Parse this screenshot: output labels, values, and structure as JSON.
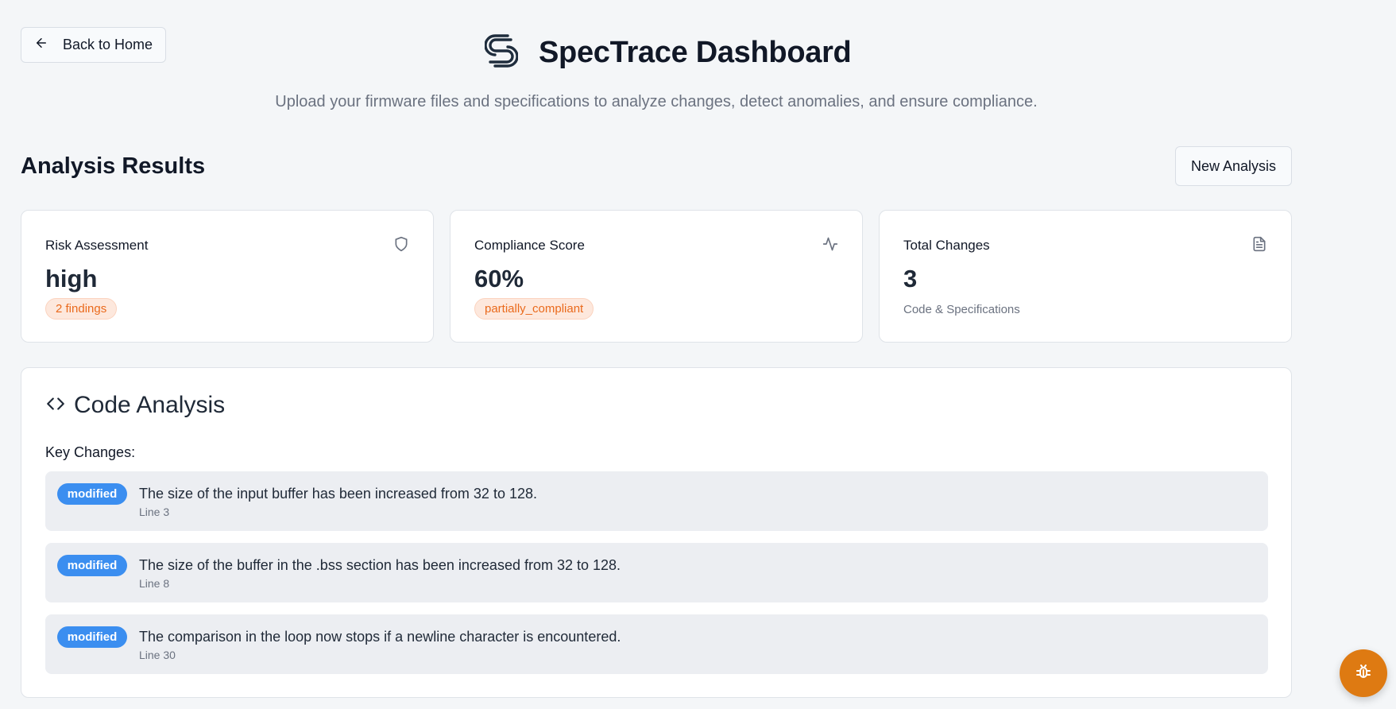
{
  "nav": {
    "back_label": "Back to Home"
  },
  "header": {
    "title": "SpecTrace Dashboard",
    "subtitle": "Upload your firmware files and specifications to analyze changes, detect anomalies, and ensure compliance."
  },
  "results": {
    "title": "Analysis Results",
    "new_analysis_label": "New Analysis"
  },
  "cards": {
    "risk": {
      "label": "Risk Assessment",
      "value": "high",
      "badge": "2 findings",
      "icon": "shield-icon"
    },
    "compliance": {
      "label": "Compliance Score",
      "value": "60%",
      "badge": "partially_compliant",
      "icon": "activity-icon"
    },
    "changes": {
      "label": "Total Changes",
      "value": "3",
      "note": "Code & Specifications",
      "icon": "document-icon"
    }
  },
  "code_analysis": {
    "title": "Code Analysis",
    "key_changes_label": "Key Changes:",
    "changes": [
      {
        "badge": "modified",
        "text": "The size of the input buffer has been increased from 32 to 128.",
        "line": "Line 3"
      },
      {
        "badge": "modified",
        "text": "The size of the buffer in the .bss section has been increased from 32 to 128.",
        "line": "Line 8"
      },
      {
        "badge": "modified",
        "text": "The comparison in the loop now stops if a newline character is encountered.",
        "line": "Line 30"
      }
    ]
  },
  "colors": {
    "accent_orange": "#de7a12",
    "badge_blue": "#3b8ef0",
    "pill_orange_text": "#ea6a1c"
  },
  "fab": {
    "icon": "bug-icon"
  }
}
